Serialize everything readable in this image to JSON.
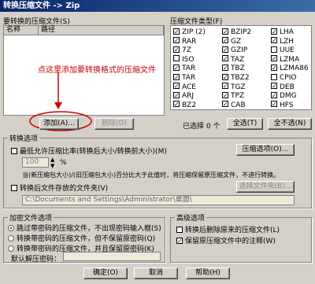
{
  "window": {
    "title": "转换压缩文件 -> Zip"
  },
  "files": {
    "label": "要转换的压缩文件(S)",
    "col_name": "名称",
    "col_path": "路径",
    "annotation": "点这里添加要转换格式的压缩文件",
    "add_button": "添加(A)...",
    "delete_button": "删除(D)"
  },
  "types": {
    "label": "压缩文件类型(F)",
    "items": [
      {
        "label": "ZIP (2)",
        "checked": true
      },
      {
        "label": "BZIP2",
        "checked": true
      },
      {
        "label": "LHA",
        "checked": true
      },
      {
        "label": "RAR",
        "checked": true
      },
      {
        "label": "GZ",
        "checked": true
      },
      {
        "label": "LZH",
        "checked": true
      },
      {
        "label": "7Z",
        "checked": true
      },
      {
        "label": "GZIP",
        "checked": true
      },
      {
        "label": "UUE",
        "checked": false
      },
      {
        "label": "ISO",
        "checked": false
      },
      {
        "label": "TAZ",
        "checked": true
      },
      {
        "label": "LZMA",
        "checked": true
      },
      {
        "label": "TAR",
        "checked": true
      },
      {
        "label": "TBZ",
        "checked": true
      },
      {
        "label": "LZMA86",
        "checked": true
      },
      {
        "label": "TAR",
        "checked": true
      },
      {
        "label": "TBZ2",
        "checked": true
      },
      {
        "label": "CPIO",
        "checked": false
      },
      {
        "label": "ACE",
        "checked": true
      },
      {
        "label": "TGZ",
        "checked": true
      },
      {
        "label": "DEB",
        "checked": true
      },
      {
        "label": "ARJ",
        "checked": true
      },
      {
        "label": "TPZ",
        "checked": true
      },
      {
        "label": "DMG",
        "checked": true
      },
      {
        "label": "BZ2",
        "checked": true
      },
      {
        "label": "CAB",
        "checked": true
      },
      {
        "label": "HFS",
        "checked": true
      }
    ],
    "selected_text": "已选择 0 个",
    "select_all": "全选(T)",
    "deselect_all": "全不选(N)"
  },
  "options": {
    "group_label": "转换选项",
    "min_ratio_label": "最低允许压缩比率(转换后大小/转换前大小)(M)",
    "compress_options_button": "压缩选项(O)...",
    "ratio_value": "100",
    "ratio_unit": "%",
    "ratio_note": "当(新压缩包大小)/(旧压缩包大小)百分比大于此值时，将压缩保留原压缩文件，不进行转换。",
    "folder_label": "转换后文件存放的文件夹(V)",
    "folder_button": "选择文件夹(B)...",
    "folder_path": "C:\\Documents and Settings\\Administrator\\桌面\\"
  },
  "encryption": {
    "group_label": "加密文件选项",
    "radio1": "跳过带密码的压缩文件，不出现密码输入框(S)",
    "radio2": "转换带密码的压缩文件，但不保留原密码(Q)",
    "radio3": "转换带密码的压缩文件，并且保留原密码(K)",
    "default_password_label": "默认解压密码："
  },
  "advanced": {
    "group_label": "高级选项",
    "opt1": "转换后删除原来的压缩文件(L)",
    "opt2": "保留原压缩文件中的注释(W)"
  },
  "footer": {
    "ok": "确定(O)",
    "cancel": "取消",
    "help": "帮助(H)"
  }
}
